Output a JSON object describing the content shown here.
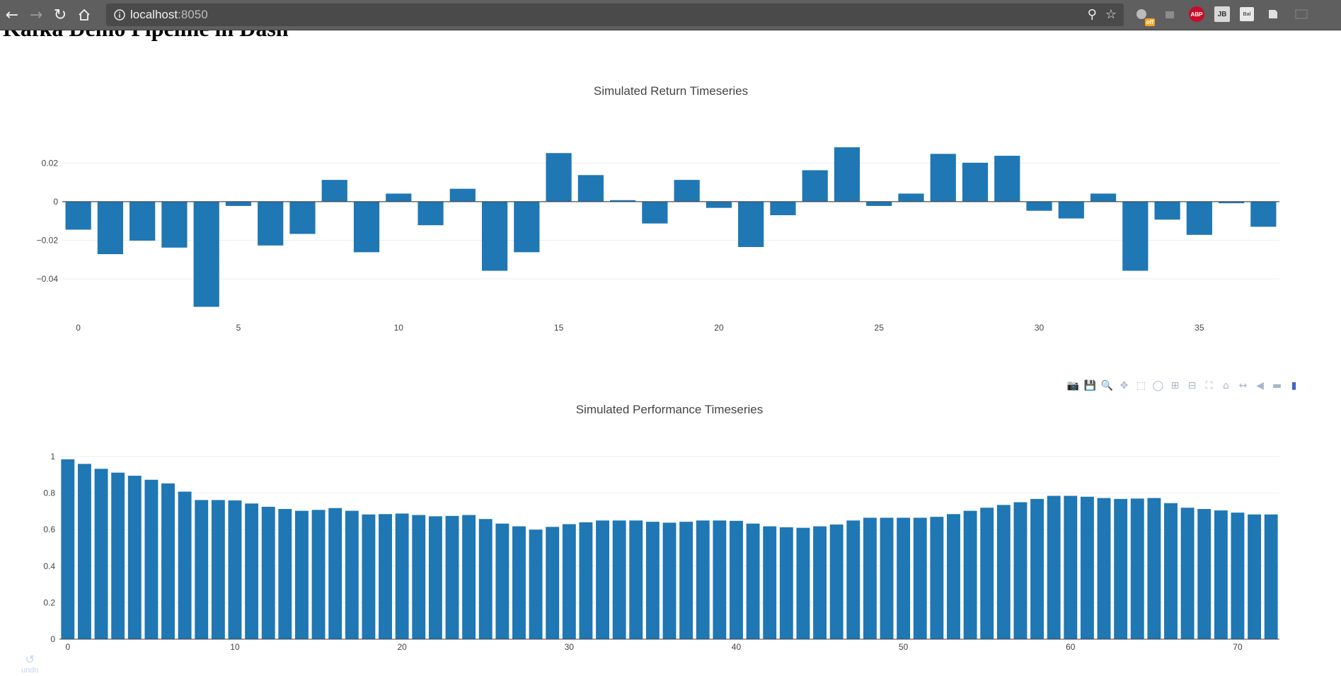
{
  "browser": {
    "url_host": "localhost",
    "url_port": ":8050",
    "back_icon": "arrow-left-icon",
    "forward_icon": "arrow-right-icon",
    "reload_icon": "reload-icon",
    "home_icon": "home-icon",
    "extensions": [
      {
        "name": "extension-icon",
        "badge": "off"
      },
      {
        "name": "puzzle-icon",
        "badge": ""
      },
      {
        "name": "adblock-icon",
        "label": "ABP"
      },
      {
        "name": "jb-icon",
        "label": "JB"
      },
      {
        "name": "box-icon",
        "label": "Bal"
      },
      {
        "name": "doc-icon",
        "label": ""
      },
      {
        "name": "cast-icon",
        "label": ""
      }
    ]
  },
  "page": {
    "title": "Kafka Demo Pipeline in Dash"
  },
  "modebar": {
    "buttons": [
      "camera-icon",
      "save-icon",
      "zoom-icon",
      "pan-icon",
      "box-select-icon",
      "lasso-icon",
      "zoom-in-icon",
      "zoom-out-icon",
      "autoscale-icon",
      "reset-axes-icon",
      "spike-lines-icon",
      "hover-closest-icon",
      "hover-compare-icon",
      "plotly-logo-icon"
    ]
  },
  "undo": {
    "label": "undo"
  },
  "chart_data": [
    {
      "type": "bar",
      "title": "Simulated Return Timeseries",
      "xlabel": "",
      "ylabel": "",
      "x": [
        0,
        1,
        2,
        3,
        4,
        5,
        6,
        7,
        8,
        9,
        10,
        11,
        12,
        13,
        14,
        15,
        16,
        17,
        18,
        19,
        20,
        21,
        22,
        23,
        24,
        25,
        26,
        27,
        28,
        29,
        30,
        31,
        32,
        33,
        34,
        35,
        36,
        37
      ],
      "values": [
        -0.0145,
        -0.0272,
        -0.0202,
        -0.0238,
        -0.0545,
        -0.0022,
        -0.0227,
        -0.0167,
        0.0113,
        -0.0262,
        0.0042,
        -0.0122,
        0.0067,
        -0.0358,
        -0.0262,
        0.0252,
        0.0138,
        0.0008,
        -0.0113,
        0.0113,
        -0.0032,
        -0.0235,
        -0.007,
        0.0163,
        0.0282,
        -0.0022,
        0.0042,
        0.0248,
        0.0202,
        0.0238,
        -0.0047,
        -0.0087,
        0.0042,
        -0.0358,
        -0.0093,
        -0.0172,
        -0.0008,
        -0.013
      ],
      "xticks": [
        "0",
        "5",
        "10",
        "15",
        "20",
        "25",
        "30",
        "35"
      ],
      "yticks": [
        "0.02",
        "0",
        "−0.02",
        "−0.04"
      ],
      "ylim": [
        -0.058,
        0.033
      ],
      "grid": true
    },
    {
      "type": "bar",
      "title": "Simulated Performance Timeseries",
      "xlabel": "",
      "ylabel": "",
      "x": [
        0,
        1,
        2,
        3,
        4,
        5,
        6,
        7,
        8,
        9,
        10,
        11,
        12,
        13,
        14,
        15,
        16,
        17,
        18,
        19,
        20,
        21,
        22,
        23,
        24,
        25,
        26,
        27,
        28,
        29,
        30,
        31,
        32,
        33,
        34,
        35,
        36,
        37,
        38,
        39,
        40,
        41,
        42,
        43,
        44,
        45,
        46,
        47,
        48,
        49,
        50,
        51,
        52,
        53,
        54,
        55,
        56,
        57,
        58,
        59,
        60,
        61,
        62,
        63,
        64,
        65,
        66,
        67,
        68,
        69,
        70,
        71,
        72
      ],
      "values": [
        0.985,
        0.96,
        0.933,
        0.912,
        0.895,
        0.873,
        0.853,
        0.808,
        0.762,
        0.762,
        0.76,
        0.743,
        0.725,
        0.713,
        0.703,
        0.708,
        0.718,
        0.703,
        0.683,
        0.685,
        0.688,
        0.68,
        0.673,
        0.675,
        0.68,
        0.658,
        0.633,
        0.618,
        0.6,
        0.615,
        0.63,
        0.64,
        0.65,
        0.65,
        0.65,
        0.643,
        0.638,
        0.643,
        0.65,
        0.65,
        0.648,
        0.633,
        0.618,
        0.613,
        0.61,
        0.618,
        0.628,
        0.65,
        0.665,
        0.665,
        0.665,
        0.665,
        0.67,
        0.685,
        0.703,
        0.72,
        0.735,
        0.75,
        0.768,
        0.785,
        0.785,
        0.78,
        0.773,
        0.768,
        0.77,
        0.773,
        0.745,
        0.72,
        0.713,
        0.705,
        0.693,
        0.683,
        0.683
      ],
      "xticks": [
        "0",
        "10",
        "20",
        "30",
        "40",
        "50",
        "60",
        "70"
      ],
      "yticks": [
        "1",
        "0.8",
        "0.6",
        "0.4",
        "0.2",
        "0"
      ],
      "ylim": [
        0,
        1.0
      ],
      "grid": true
    }
  ]
}
